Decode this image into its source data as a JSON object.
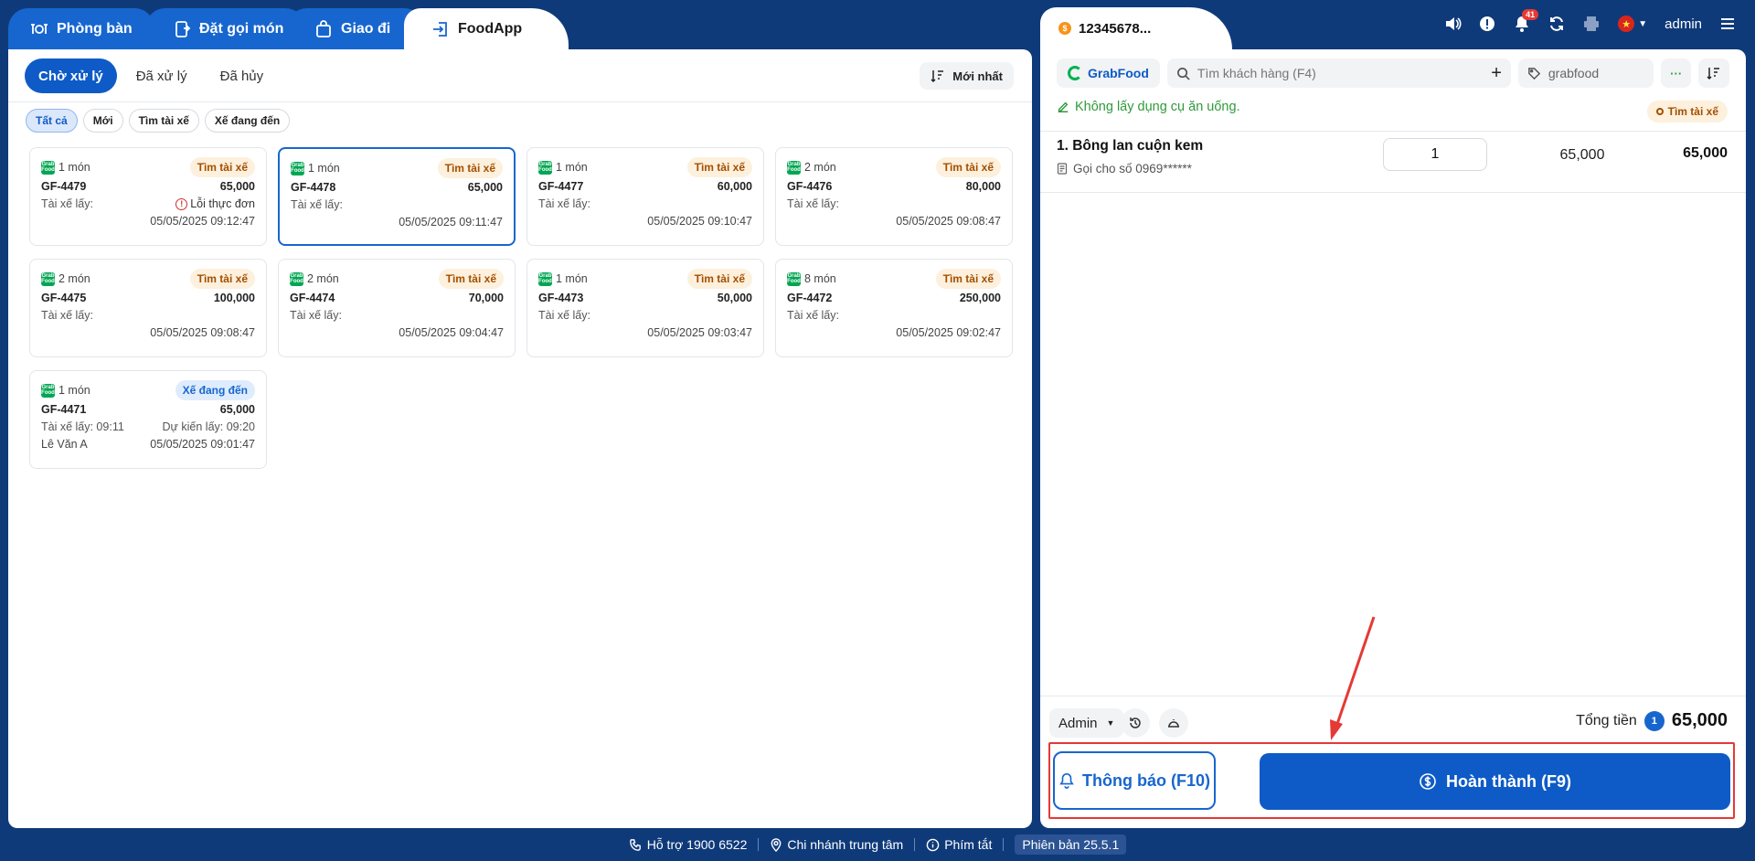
{
  "tabs": [
    {
      "label": "Phòng bàn",
      "icon": "table-service-icon"
    },
    {
      "label": "Đặt gọi món",
      "icon": "order-icon"
    },
    {
      "label": "Giao đi",
      "icon": "bag-icon"
    },
    {
      "label": "FoodApp",
      "icon": "login-icon"
    }
  ],
  "status_tabs": [
    "Chờ xử lý",
    "Đã xử lý",
    "Đã hủy"
  ],
  "sort_label": "Mới nhất",
  "filter_chips": [
    "Tất cả",
    "Mới",
    "Tìm tài xế",
    "Xế đang đến"
  ],
  "orders": [
    {
      "items": "1 món",
      "status": "Tìm tài xế",
      "code": "GF-4479",
      "amount": "65,000",
      "driver_label": "Tài xế lấy:",
      "extra": "Lỗi thực đơn",
      "name": "",
      "time": "05/05/2025 09:12:47"
    },
    {
      "items": "1 món",
      "status": "Tìm tài xế",
      "code": "GF-4478",
      "amount": "65,000",
      "driver_label": "Tài xế lấy:",
      "extra": "",
      "name": "",
      "time": "05/05/2025 09:11:47"
    },
    {
      "items": "1 món",
      "status": "Tìm tài xế",
      "code": "GF-4477",
      "amount": "60,000",
      "driver_label": "Tài xế lấy:",
      "extra": "",
      "name": "",
      "time": "05/05/2025 09:10:47"
    },
    {
      "items": "2 món",
      "status": "Tìm tài xế",
      "code": "GF-4476",
      "amount": "80,000",
      "driver_label": "Tài xế lấy:",
      "extra": "",
      "name": "",
      "time": "05/05/2025 09:08:47"
    },
    {
      "items": "2 món",
      "status": "Tìm tài xế",
      "code": "GF-4475",
      "amount": "100,000",
      "driver_label": "Tài xế lấy:",
      "extra": "",
      "name": "",
      "time": "05/05/2025 09:08:47"
    },
    {
      "items": "2 món",
      "status": "Tìm tài xế",
      "code": "GF-4474",
      "amount": "70,000",
      "driver_label": "Tài xế lấy:",
      "extra": "",
      "name": "",
      "time": "05/05/2025 09:04:47"
    },
    {
      "items": "1 món",
      "status": "Tìm tài xế",
      "code": "GF-4473",
      "amount": "50,000",
      "driver_label": "Tài xế lấy:",
      "extra": "",
      "name": "",
      "time": "05/05/2025 09:03:47"
    },
    {
      "items": "8 món",
      "status": "Tìm tài xế",
      "code": "GF-4472",
      "amount": "250,000",
      "driver_label": "Tài xế lấy:",
      "extra": "",
      "name": "",
      "time": "05/05/2025 09:02:47"
    },
    {
      "items": "1 món",
      "status": "Xế đang đến",
      "code": "GF-4471",
      "amount": "65,000",
      "driver_label": "Tài xế lấy: 09:11",
      "extra": "Dự kiến lấy: 09:20",
      "name": "Lê Văn A",
      "time": "05/05/2025 09:01:47"
    }
  ],
  "order_panel": {
    "title": "12345678...",
    "channel": "GrabFood",
    "search_placeholder": "Tìm khách hàng (F4)",
    "tag_placeholder": "grabfood",
    "note": "Không lấy dụng cụ ăn uống.",
    "status_badge": "Tìm tài xế",
    "item_name": "1. Bông lan cuộn kem",
    "item_note": "Gọi cho số 0969******",
    "item_qty": "1",
    "item_price": "65,000",
    "item_total": "65,000",
    "staff": "Admin",
    "total_label": "Tổng tiền",
    "total_count": "1",
    "total_value": "65,000",
    "notify_label": "Thông báo (F10)",
    "complete_label": "Hoàn thành (F9)"
  },
  "topbar": {
    "notification_count": "41",
    "user": "admin"
  },
  "statusbar": {
    "support": "Hỗ trợ 1900 6522",
    "branch": "Chi nhánh trung tâm",
    "shortcuts": "Phím tắt",
    "version": "Phiên bản 25.5.1"
  },
  "colors": {
    "primary": "#0e5bc7",
    "header_bg": "#0f3a7a",
    "status_orange_bg": "#fdf0dc",
    "status_orange_text": "#a34f00",
    "annotation_red": "#e53935"
  }
}
